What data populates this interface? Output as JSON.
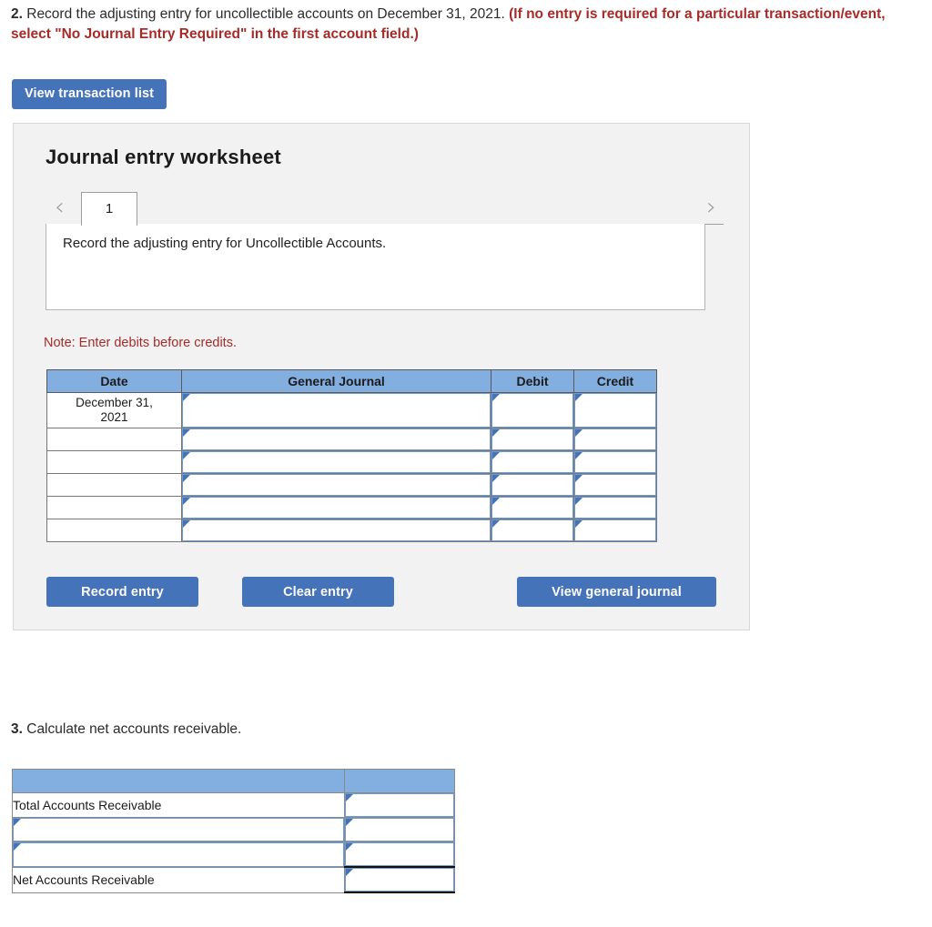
{
  "question2": {
    "number": "2.",
    "text": " Record the adjusting entry for uncollectible accounts on December 31, 2021. ",
    "red_note": "(If no entry is required for a particular transaction/event, select \"No Journal Entry Required\" in the first account field.)"
  },
  "view_transaction_list_label": "View transaction list",
  "worksheet": {
    "title": "Journal entry worksheet",
    "prev_arrow": "‹",
    "next_arrow": "›",
    "tabs": [
      {
        "label": "1",
        "active": true
      }
    ],
    "instruction": "Record the adjusting entry for Uncollectible Accounts.",
    "debit_note": "Note: Enter debits before credits.",
    "table": {
      "headers": [
        "Date",
        "General Journal",
        "Debit",
        "Credit"
      ],
      "rows": [
        {
          "date": "December 31,\n2021",
          "general_journal": "",
          "debit": "",
          "credit": ""
        },
        {
          "date": "",
          "general_journal": "",
          "debit": "",
          "credit": ""
        },
        {
          "date": "",
          "general_journal": "",
          "debit": "",
          "credit": ""
        },
        {
          "date": "",
          "general_journal": "",
          "debit": "",
          "credit": ""
        },
        {
          "date": "",
          "general_journal": "",
          "debit": "",
          "credit": ""
        },
        {
          "date": "",
          "general_journal": "",
          "debit": "",
          "credit": ""
        }
      ],
      "first_row_date_line1": "December 31,",
      "first_row_date_line2": "2021"
    },
    "buttons": {
      "record_entry": "Record entry",
      "clear_entry": "Clear entry",
      "view_general_journal": "View general journal"
    }
  },
  "question3": {
    "number": "3.",
    "text": " Calculate net accounts receivable.",
    "table": {
      "headers": [
        "",
        ""
      ],
      "rows": [
        {
          "label": "Total Accounts Receivable",
          "label_editable": false,
          "value": "",
          "total": false
        },
        {
          "label": "",
          "label_editable": true,
          "value": "",
          "total": false
        },
        {
          "label": "",
          "label_editable": true,
          "value": "",
          "total": false
        },
        {
          "label": "Net Accounts Receivable",
          "label_editable": false,
          "value": "",
          "total": true
        }
      ]
    }
  },
  "colors": {
    "header_blue": "#82AEE0",
    "button_blue": "#4573B9",
    "panel_gray": "#F2F2F2",
    "note_red": "#a62b28",
    "input_border_blue": "#6f9bd1"
  }
}
